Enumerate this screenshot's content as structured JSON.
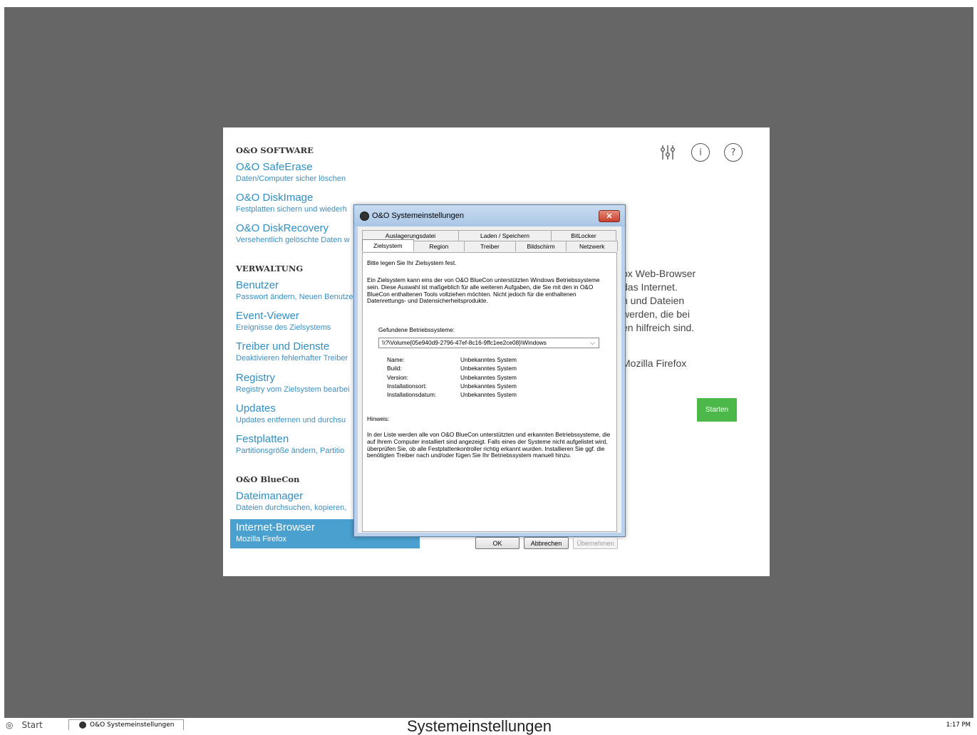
{
  "app": {
    "sections": [
      {
        "title": "O&O SOFTWARE"
      },
      {
        "title": "VERWALTUNG"
      },
      {
        "title": "O&O BlueCon"
      }
    ],
    "items": [
      {
        "title": "O&O SafeErase",
        "sub": "Daten/Computer sicher löschen"
      },
      {
        "title": "O&O DiskImage",
        "sub": "Festplatten sichern und wiederh"
      },
      {
        "title": "O&O DiskRecovery",
        "sub": "Versehentlich gelöschte Daten w"
      },
      {
        "title": "Benutzer",
        "sub": "Passwort ändern, Neuen Benutze"
      },
      {
        "title": "Event-Viewer",
        "sub": "Ereignisse des Zielsystems"
      },
      {
        "title": "Treiber und Dienste",
        "sub": "Deaktivieren fehlerhafter Treiber"
      },
      {
        "title": "Registry",
        "sub": "Registry vom Zielsystem bearbei"
      },
      {
        "title": "Updates",
        "sub": "Updates entfernen und durchsu"
      },
      {
        "title": "Festplatten",
        "sub": "Partitionsgröße ändern, Partitio"
      },
      {
        "title": "Dateimanager",
        "sub": "Dateien durchsuchen, kopieren,"
      },
      {
        "title": "Internet-Browser",
        "sub": "Mozilla Firefox"
      }
    ],
    "description_lines": [
      "ox Web-Browser",
      "das Internet.",
      "n und Dateien",
      "werden, die bei",
      "en hilfreich sind."
    ],
    "browser_name": "Mozilla Firefox",
    "start_label": "Starten",
    "icons": [
      "settings-sliders-icon",
      "info-icon",
      "help-icon"
    ]
  },
  "dialog": {
    "title": "O&O Systemeinstellungen",
    "close_label": "✕",
    "tabs_top": [
      "Auslagerungsdatei",
      "Laden / Speichern",
      "BitLocker"
    ],
    "tabs_bottom": [
      "Zielsystem",
      "Region",
      "Treiber",
      "Bildschirm",
      "Netzwerk"
    ],
    "selected_tab": "Zielsystem",
    "intro": "Bitte legen Sie Ihr Zielsystem fest.",
    "description": "Ein Zielsystem kann eins der von O&O BlueCon unterstützten Windows Betriebssysteme sein. Diese Auswahl ist maßgeblich für alle weiteren Aufgaben, die Sie mit den in O&O BlueCon enthaltenen Tools vollziehen möchten. Nicht jedoch für die enthaltenen Datenrettungs- und Datensicherheitsprodukte.",
    "found_label": "Gefundene Betriebssysteme:",
    "selected_os": "\\\\?\\Volume{05e940d9-2796-47ef-8c16-9ffc1ee2ce08}\\Windows",
    "info": [
      {
        "label": "Name:",
        "value": "Unbekanntes System"
      },
      {
        "label": "Build:",
        "value": "Unbekanntes System"
      },
      {
        "label": "Version:",
        "value": "Unbekanntes System"
      },
      {
        "label": "Installationsort:",
        "value": "Unbekanntes System"
      },
      {
        "label": "Installationsdatum:",
        "value": "Unbekanntes System"
      }
    ],
    "hint_label": "Hinweis:",
    "hint_text": "In der Liste werden alle von O&O BlueCon unterstützten und erkannten Betriebssysteme, die auf Ihrem Computer installiert sind angezeigt. Falls eines der Systeme nicht aufgelistet wird, überprüfen Sie, ob alle Festplattenkontroller richtig erkannt wurden. Installieren Sie ggf. die benötigten Treiber nach und/oder fügen Sie Ihr Betriebssystem manuell hinzu.",
    "buttons": {
      "ok": "OK",
      "cancel": "Abbrechen",
      "apply": "Übernehmen"
    }
  },
  "taskbar": {
    "start_label": "Start",
    "task_label": "O&O Systemeinstellungen",
    "center_title": "Systemeinstellungen",
    "clock": "1:17 PM"
  }
}
